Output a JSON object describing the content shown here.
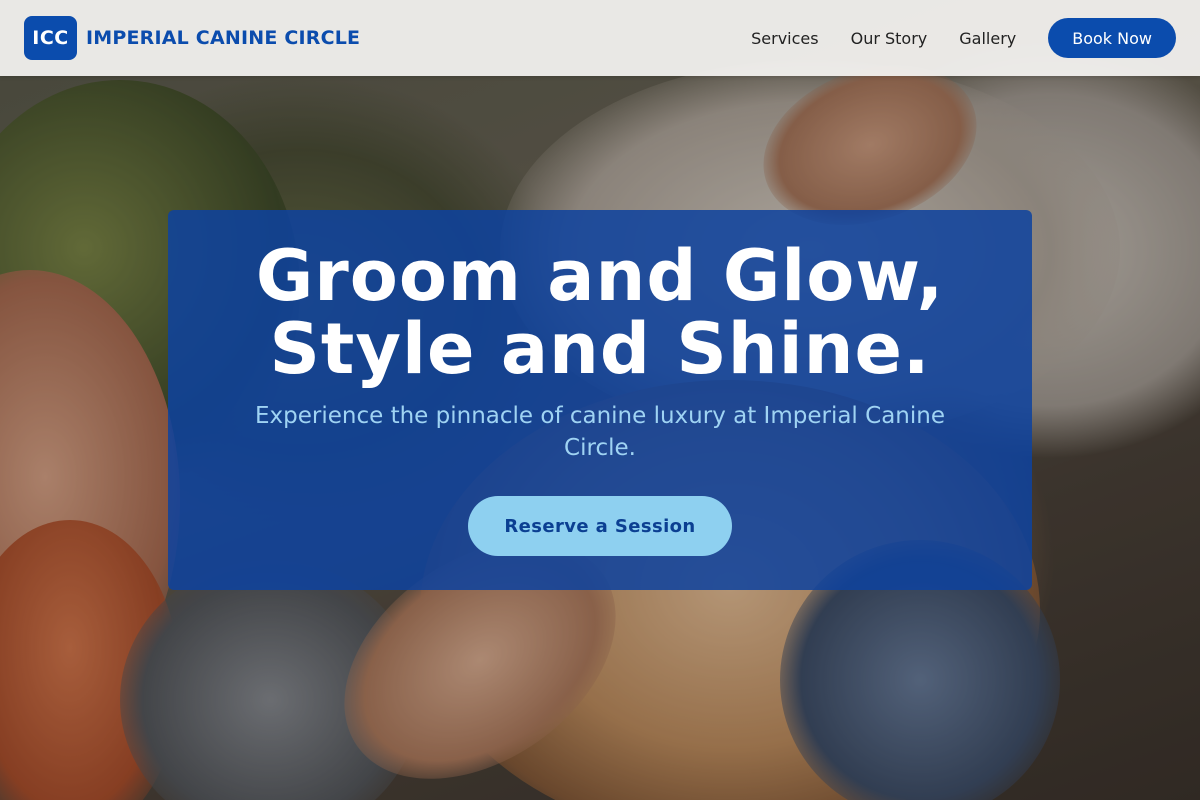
{
  "brand": {
    "logo_text": "ICC",
    "name": "IMPERIAL CANINE CIRCLE",
    "accent_color": "#0b4cad"
  },
  "nav": {
    "links": [
      "Services",
      "Our Story",
      "Gallery"
    ],
    "book_label": "Book Now"
  },
  "hero": {
    "title_line1": "Groom and Glow,",
    "title_line2": "Style and Shine.",
    "subtitle": "Experience the pinnacle of canine luxury at Imperial Canine Circle.",
    "cta_label": "Reserve a Session"
  }
}
